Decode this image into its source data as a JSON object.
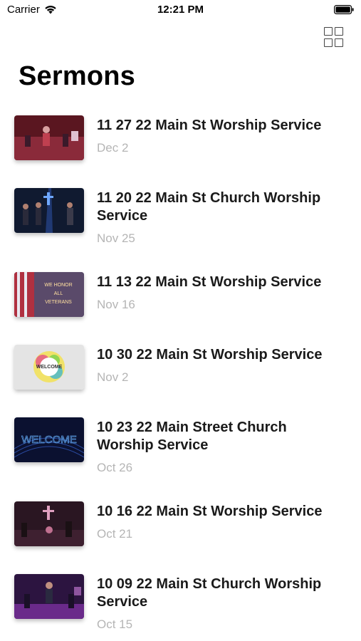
{
  "status_bar": {
    "carrier": "Carrier",
    "time": "12:21 PM"
  },
  "header": {
    "title": "Sermons",
    "grid_icon": "grid-view-icon"
  },
  "sermons": [
    {
      "title": "11 27 22 Main St Worship Service",
      "date": "Dec 2",
      "thumb_color": "#6b1a24"
    },
    {
      "title": "11 20 22 Main St Church Worship Service",
      "date": "Nov 25",
      "thumb_color": "#12203a"
    },
    {
      "title": "11 13 22 Main St Worship Service",
      "date": "Nov 16",
      "thumb_color": "#4a3a5a",
      "thumb_text": "WE HONOR ALL VETERANS"
    },
    {
      "title": "10 30 22 Main St Worship Service",
      "date": "Nov 2",
      "thumb_color": "#e6e6e6",
      "thumb_text": "WELCOME"
    },
    {
      "title": "10 23 22 Main Street Church Worship Service",
      "date": "Oct 26",
      "thumb_color": "#0c1230",
      "thumb_text": "WELCOME"
    },
    {
      "title": "10 16 22 Main St Worship Service",
      "date": "Oct 21",
      "thumb_color": "#2a1420"
    },
    {
      "title": "10 09 22 Main St Church Worship Service",
      "date": "Oct 15",
      "thumb_color": "#2e1640"
    }
  ]
}
